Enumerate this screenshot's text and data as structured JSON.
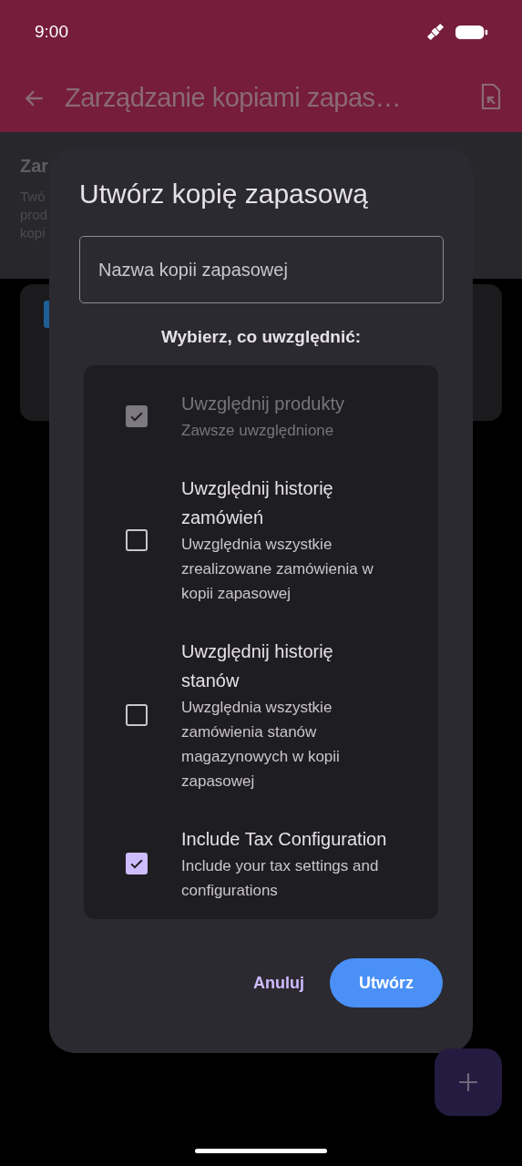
{
  "status_bar": {
    "time": "9:00"
  },
  "app_bar": {
    "title": "Zarządzanie kopiami zapas…"
  },
  "background": {
    "section_title": "Zar",
    "section_lines": [
      "Twó",
      "prod",
      "kopi"
    ]
  },
  "dialog": {
    "title": "Utwórz kopię zapasową",
    "name_field": {
      "placeholder": "Nazwa kopii zapasowej"
    },
    "section_label": "Wybierz, co uwzględnić:",
    "options": [
      {
        "title": "Uwzględnij produkty",
        "subtitle": "Zawsze uwzględnione",
        "checked": true,
        "disabled": true
      },
      {
        "title": "Uwzględnij historię zamówień",
        "subtitle": "Uwzględnia wszystkie zrealizowane zamówienia w kopii zapasowej",
        "checked": false,
        "disabled": false
      },
      {
        "title": "Uwzględnij historię stanów",
        "subtitle": "Uwzględnia wszystkie zamówienia stanów magazynowych w kopii zapasowej",
        "checked": false,
        "disabled": false
      },
      {
        "title": "Include Tax Configuration",
        "subtitle": "Include your tax settings and configurations",
        "checked": true,
        "disabled": false
      }
    ],
    "buttons": [
      {
        "label": "Anuluj",
        "kind": "text"
      },
      {
        "label": "Utwórz",
        "kind": "filled"
      }
    ]
  }
}
